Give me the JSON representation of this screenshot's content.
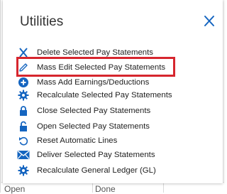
{
  "background": {
    "row_text": [
      "Open",
      "Done"
    ]
  },
  "dialog": {
    "title": "Utilities",
    "close_icon": "close-icon",
    "accent_color": "#1565c0",
    "highlight_color": "#d6262e",
    "highlighted_item": "Mass Edit Selected Pay Statements",
    "items": [
      {
        "label": "Delete Selected Pay Statements",
        "icon": "delete-x-icon"
      },
      {
        "label": "Mass Edit Selected Pay Statements",
        "icon": "pencil-icon"
      },
      {
        "label": "Mass Add Earnings/Deductions",
        "icon": "plus-circle-icon"
      },
      {
        "label": "Recalculate Selected Pay Statements",
        "icon": "gear-icon"
      },
      {
        "label": "Close Selected Pay Statements",
        "icon": "lock-closed-icon"
      },
      {
        "label": "Open Selected Pay Statements",
        "icon": "lock-open-icon"
      },
      {
        "label": "Reset Automatic Lines",
        "icon": "undo-arrow-icon"
      },
      {
        "label": "Deliver Selected Pay Statements",
        "icon": "envelope-icon"
      },
      {
        "label": "Recalculate General Ledger (GL)",
        "icon": "gear-icon"
      }
    ]
  }
}
